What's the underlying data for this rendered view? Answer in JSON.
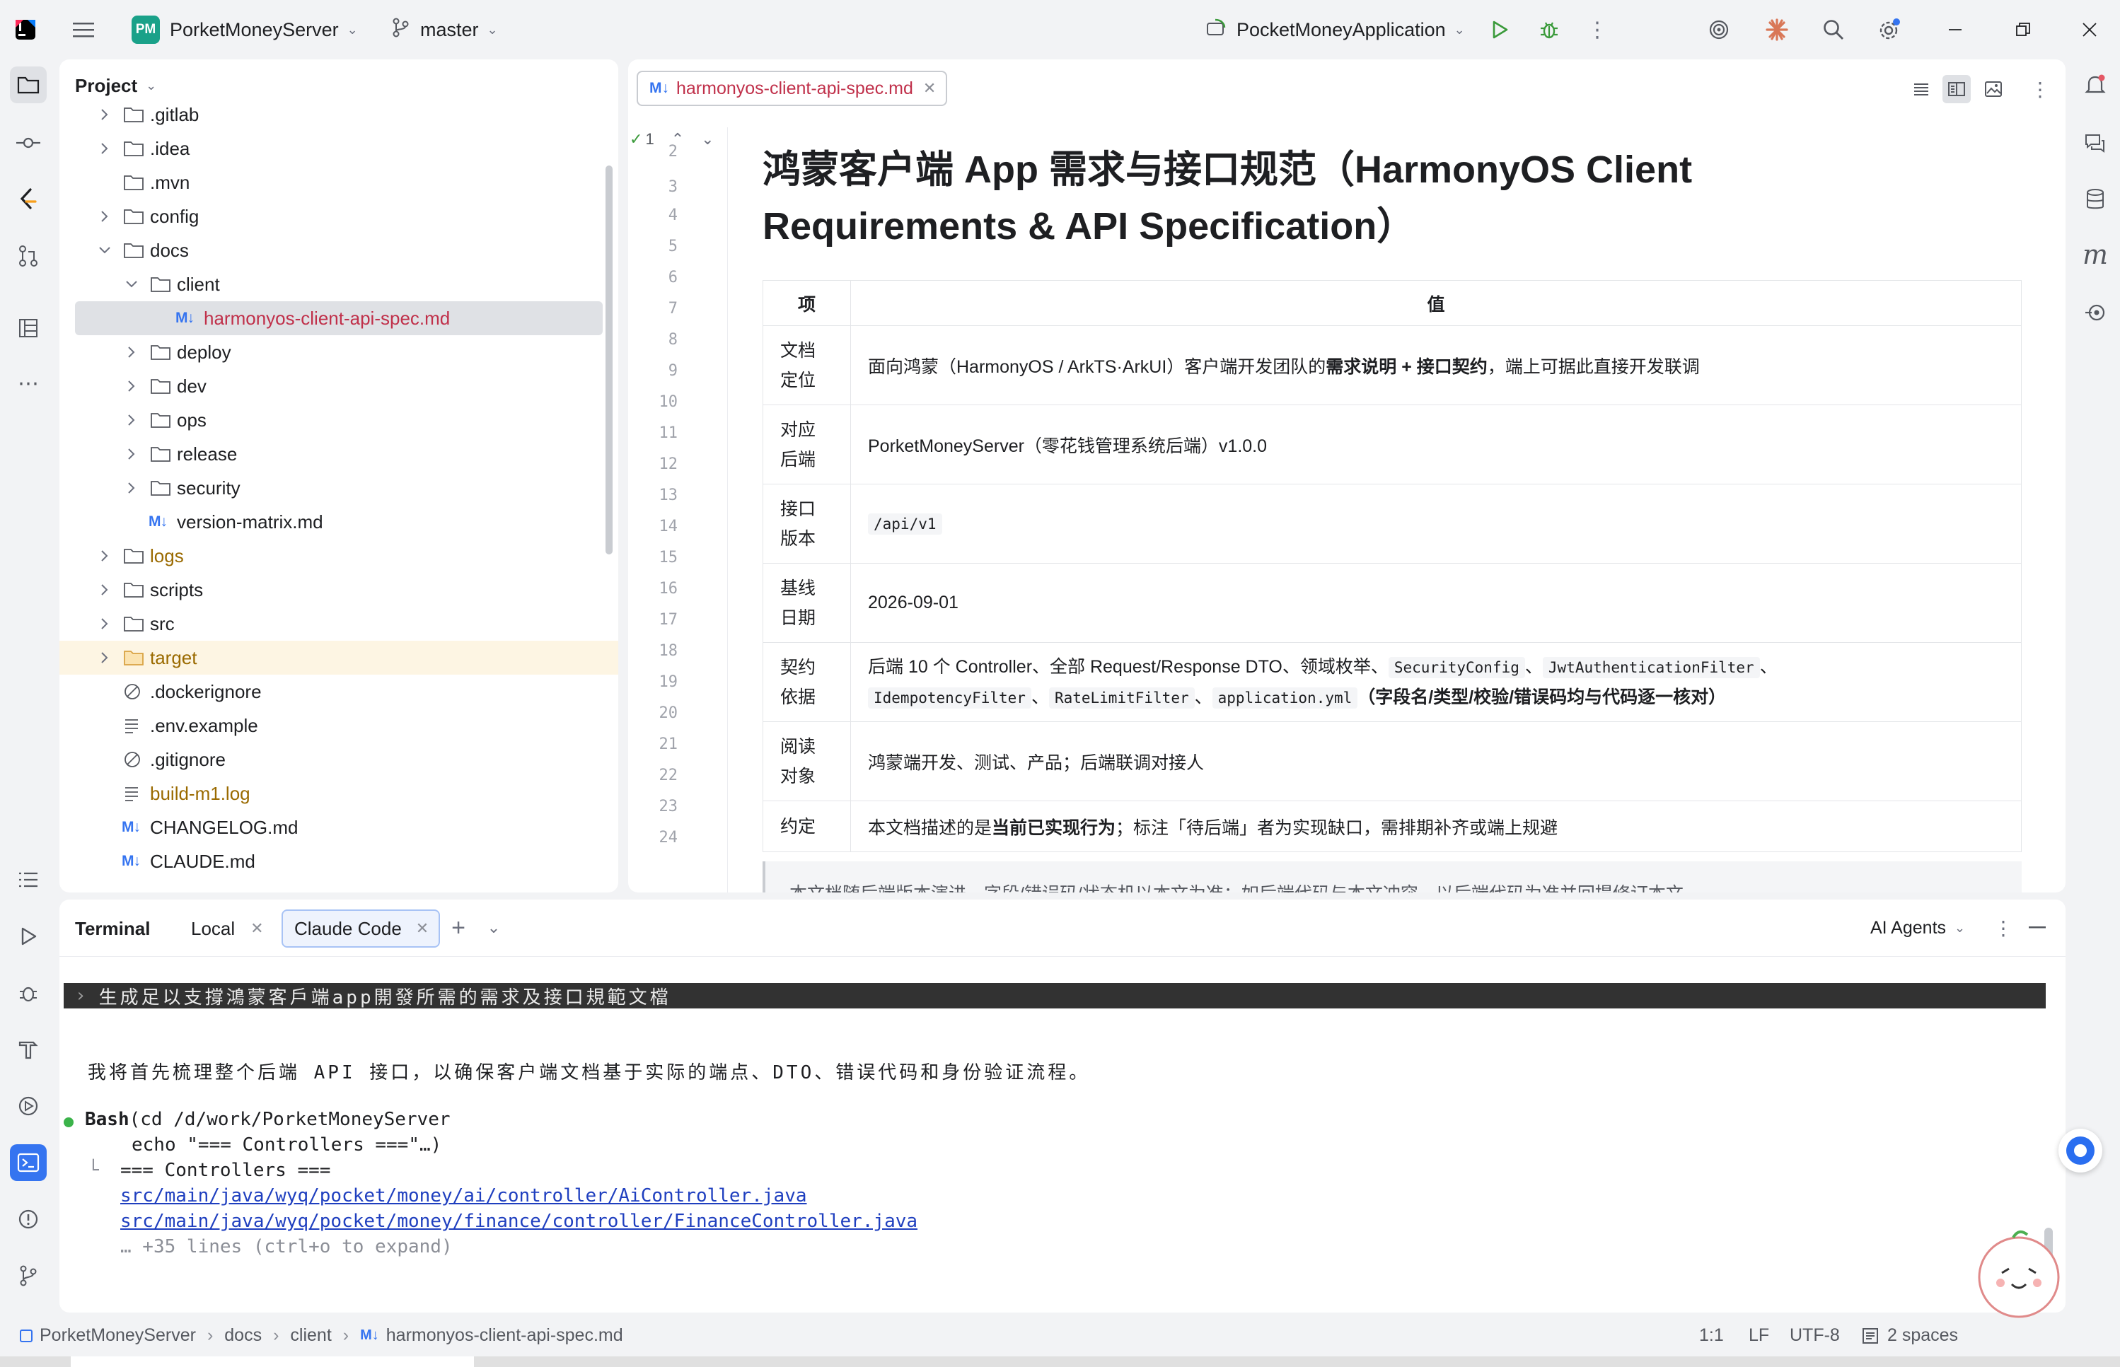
{
  "titlebar": {
    "project_badge": "PM",
    "project_name": "PorketMoneyServer",
    "branch": "master",
    "run_config": "PocketMoneyApplication"
  },
  "project_panel": {
    "title": "Project",
    "tree": [
      {
        "label": ".gitlab",
        "type": "folder",
        "depth": 1,
        "expandable": true
      },
      {
        "label": ".idea",
        "type": "folder",
        "depth": 1,
        "expandable": true
      },
      {
        "label": ".mvn",
        "type": "folder",
        "depth": 1,
        "expandable": false
      },
      {
        "label": "config",
        "type": "folder",
        "depth": 1,
        "expandable": true
      },
      {
        "label": "docs",
        "type": "folder",
        "depth": 1,
        "expandable": true,
        "expanded": true
      },
      {
        "label": "client",
        "type": "folder",
        "depth": 2,
        "expandable": true,
        "expanded": true
      },
      {
        "label": "harmonyos-client-api-spec.md",
        "type": "md",
        "depth": 3,
        "selected": true
      },
      {
        "label": "deploy",
        "type": "folder",
        "depth": 2,
        "expandable": true
      },
      {
        "label": "dev",
        "type": "folder",
        "depth": 2,
        "expandable": true
      },
      {
        "label": "ops",
        "type": "folder",
        "depth": 2,
        "expandable": true
      },
      {
        "label": "release",
        "type": "folder",
        "depth": 2,
        "expandable": true
      },
      {
        "label": "security",
        "type": "folder",
        "depth": 2,
        "expandable": true
      },
      {
        "label": "version-matrix.md",
        "type": "md",
        "depth": 2
      },
      {
        "label": "logs",
        "type": "folder",
        "depth": 1,
        "expandable": true,
        "color": "#9a6a00"
      },
      {
        "label": "scripts",
        "type": "folder",
        "depth": 1,
        "expandable": true
      },
      {
        "label": "src",
        "type": "folder",
        "depth": 1,
        "expandable": true
      },
      {
        "label": "target",
        "type": "folder-excluded",
        "depth": 1,
        "expandable": true,
        "color": "#9a6a00",
        "highlight": true
      },
      {
        "label": ".dockerignore",
        "type": "ignore",
        "depth": 1
      },
      {
        "label": ".env.example",
        "type": "text",
        "depth": 1
      },
      {
        "label": ".gitignore",
        "type": "ignore",
        "depth": 1
      },
      {
        "label": "build-m1.log",
        "type": "text",
        "depth": 1,
        "color": "#9a6a00"
      },
      {
        "label": "CHANGELOG.md",
        "type": "md",
        "depth": 1
      },
      {
        "label": "CLAUDE.md",
        "type": "md",
        "depth": 1
      }
    ]
  },
  "editor": {
    "tab_label": "harmonyos-client-api-spec.md",
    "inspection_count": "1",
    "line_numbers": [
      "2",
      "3",
      "4",
      "5",
      "6",
      "7",
      "8",
      "9",
      "10",
      "11",
      "12",
      "13",
      "14",
      "15",
      "16",
      "17",
      "18",
      "19",
      "20",
      "21",
      "22",
      "23",
      "24"
    ],
    "doc_title_line1": "鸿蒙客户端 App 需求与接口规范（HarmonyOS Client",
    "doc_title_line2": "Requirements & API Specification）",
    "table_header": {
      "key": "项",
      "value": "值"
    },
    "rows": {
      "r1": {
        "k1": "文档",
        "k2": "定位",
        "pre": "面向鸿蒙（HarmonyOS / ArkTS·ArkUI）客户端开发团队的",
        "bold": "需求说明 + 接口契约",
        "post": "，端上可据此直接开发联调"
      },
      "r2": {
        "k1": "对应",
        "k2": "后端",
        "text": "PorketMoneyServer（零花钱管理系统后端）v1.0.0"
      },
      "r3": {
        "k1": "接口",
        "k2": "版本",
        "code": "/api/v1"
      },
      "r4": {
        "k1": "基线",
        "k2": "日期",
        "text": "2026-09-01"
      },
      "r5": {
        "k1": "契约",
        "k2": "依据",
        "pre": "后端 10 个 Controller、全部 Request/Response DTO、领域枚举、",
        "c1": "SecurityConfig",
        "sep1": "、",
        "c2": "JwtAuthenticationFilter",
        "sep2": "、",
        "c3": "IdempotencyFilter",
        "sep3": "、",
        "c4": "RateLimitFilter",
        "sep4": "、",
        "c5": "application.yml",
        "bold": "（字段名/类型/校验/错误码均与代码逐一核对）"
      },
      "r6": {
        "k1": "阅读",
        "k2": "对象",
        "text": "鸿蒙端开发、测试、产品；后端联调对接人"
      },
      "r7": {
        "k1": "约定",
        "pre": "本文档描述的是",
        "bold": "当前已实现行为",
        "post": "；标注「待后端」者为实现缺口，需排期补齐或端上规避"
      }
    },
    "quote_partial": "本文档随后端版本演进，字段/错误码/状态机以本文为准；如后端代码与本文冲突，以后端代码为准并回提修订本文。"
  },
  "terminal": {
    "title": "Terminal",
    "tabs": [
      {
        "label": "Local"
      },
      {
        "label": "Claude Code",
        "active": true
      }
    ],
    "ai_agents": "AI Agents",
    "prompt": "生成足以支撐鴻蒙客戶端app開發所需的需求及接口規範文檔",
    "response": "我将首先梳理整个后端 API 接口，以确保客户端文档基于实际的端点、DTO、错误代码和身份验证流程。",
    "tool_name": "Bash",
    "tool_arg1": "(cd /d/work/PorketMoneyServer",
    "tool_arg2": "echo \"=== Controllers ===\"…)",
    "out1": "=== Controllers ===",
    "out2": "src/main/java/wyq/pocket/money/ai/controller/AiController.java",
    "out3": "src/main/java/wyq/pocket/money/finance/controller/FinanceController.java",
    "out4": "… +35 lines (ctrl+o to expand)"
  },
  "statusbar": {
    "crumbs": [
      "PorketMoneyServer",
      "docs",
      "client",
      "harmonyos-client-api-spec.md"
    ],
    "position": "1:1",
    "line_sep": "LF",
    "encoding": "UTF-8",
    "indent": "2 spaces"
  },
  "colors": {
    "accent": "#3574f0",
    "selected": "#dfe1e5",
    "excluded": "#9a6a00",
    "link": "#1f3fbf",
    "md_red": "#c0304a"
  }
}
